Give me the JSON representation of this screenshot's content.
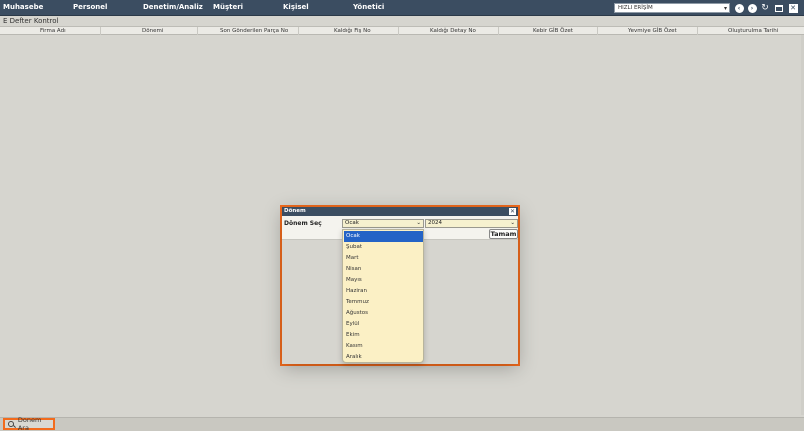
{
  "menu": {
    "items": [
      "Muhasebe",
      "Personel",
      "Denetim/Analiz",
      "Müşteri",
      "Kişisel",
      "Yönetici"
    ],
    "quick_access": "HIZLI ERİŞİM"
  },
  "page": {
    "title": "E Defter Kontrol"
  },
  "grid": {
    "columns": [
      "Firma Adı",
      "Dönemi",
      "Son Gönderilen Parça No",
      "Kaldığı Fiş No",
      "Kaldığı Detay No",
      "Kebir GİB Özet",
      "Yevmiye GİB Özet",
      "Oluşturulma Tarihi"
    ]
  },
  "dialog": {
    "title": "Dönem",
    "label": "Dönem Seç",
    "month_value": "Ocak",
    "year_value": "2024",
    "ok_label": "Tamam"
  },
  "months": [
    "Ocak",
    "Şubat",
    "Mart",
    "Nisan",
    "Mayıs",
    "Haziran",
    "Temmuz",
    "Ağustos",
    "Eylül",
    "Ekim",
    "Kasım",
    "Aralık"
  ],
  "bottom": {
    "search_label": "Donem Ara"
  }
}
